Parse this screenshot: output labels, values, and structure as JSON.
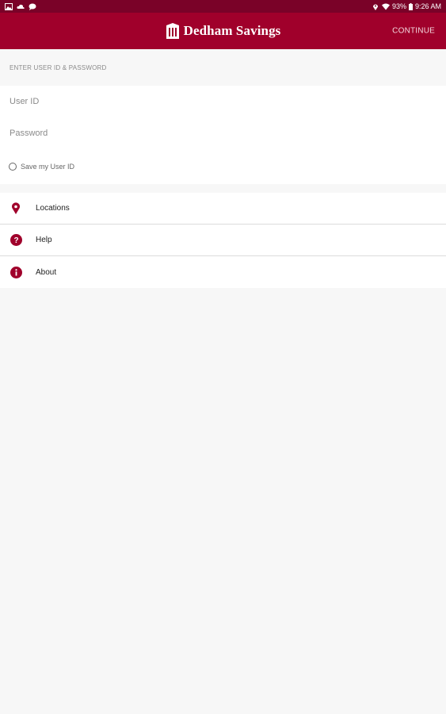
{
  "status_bar": {
    "battery": "93%",
    "time": "9:26 AM"
  },
  "app_bar": {
    "title": "Dedham Savings",
    "continue_label": "CONTINUE"
  },
  "login": {
    "section_header": "ENTER USER ID & PASSWORD",
    "user_id_placeholder": "User ID",
    "password_placeholder": "Password",
    "save_user_id_label": "Save my User ID"
  },
  "menu": {
    "items": [
      {
        "label": "Locations",
        "icon": "location-pin-icon"
      },
      {
        "label": "Help",
        "icon": "help-icon"
      },
      {
        "label": "About",
        "icon": "info-icon"
      }
    ]
  },
  "colors": {
    "brand": "#a0002b",
    "status_bar": "#7a0228",
    "background": "#f7f7f7"
  }
}
